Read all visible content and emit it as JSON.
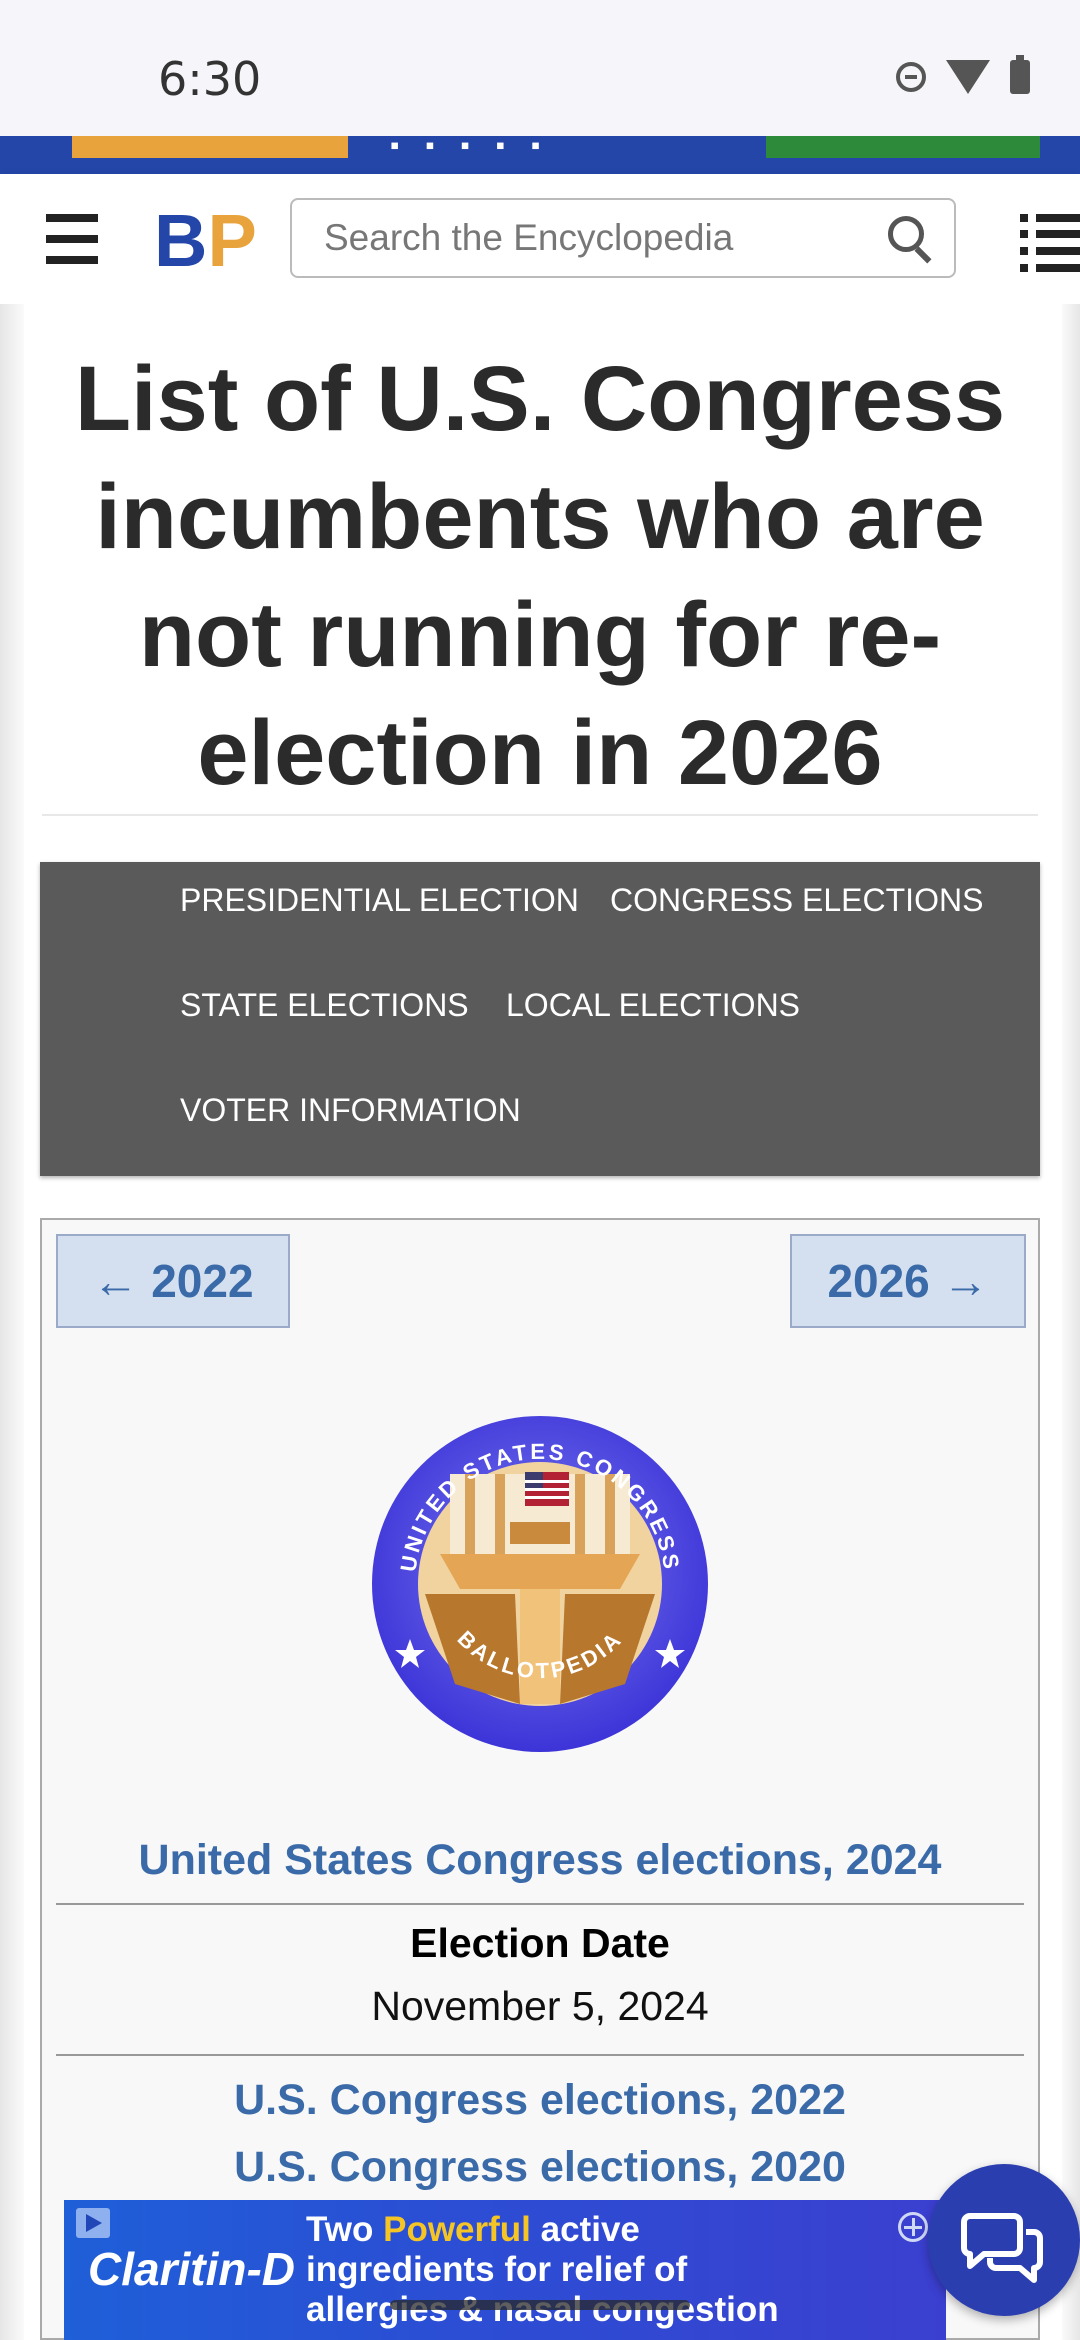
{
  "status_bar": {
    "time": "6:30",
    "icons": [
      "do-not-disturb-icon",
      "wifi-icon",
      "battery-icon"
    ]
  },
  "header": {
    "logo": {
      "b": "B",
      "p": "P"
    },
    "search_placeholder": "Search the Encyclopedia"
  },
  "page": {
    "title": "List of U.S. Congress incumbents who are not running for re-election in 2026"
  },
  "nav": {
    "items": [
      "PRESIDENTIAL ELECTION",
      "CONGRESS ELECTIONS",
      "STATE ELECTIONS",
      "LOCAL ELECTIONS",
      "VOTER INFORMATION"
    ]
  },
  "infobox": {
    "prev_label": "← 2022",
    "next_label": "2026 →",
    "seal": {
      "top_text": "UNITED STATES CONGRESS",
      "bottom_text": "BALLOTPEDIA"
    },
    "main_link": "United States Congress elections, 2024",
    "election_date_label": "Election Date",
    "election_date_value": "November 5, 2024",
    "related_links": [
      "U.S. Congress elections, 2022",
      "U.S. Congress elections, 2020"
    ]
  },
  "ad": {
    "brand": "Claritin-D",
    "line1_a": "Two ",
    "line1_hl": "Powerful",
    "line1_b": " active",
    "line2": "ingredients for relief of",
    "line3": "allergies & nasal congestion"
  },
  "colors": {
    "brand_blue": "#2446a8",
    "brand_orange": "#e8a33d",
    "link_blue": "#3a6aa8",
    "nav_gray": "#5a5a5a"
  }
}
